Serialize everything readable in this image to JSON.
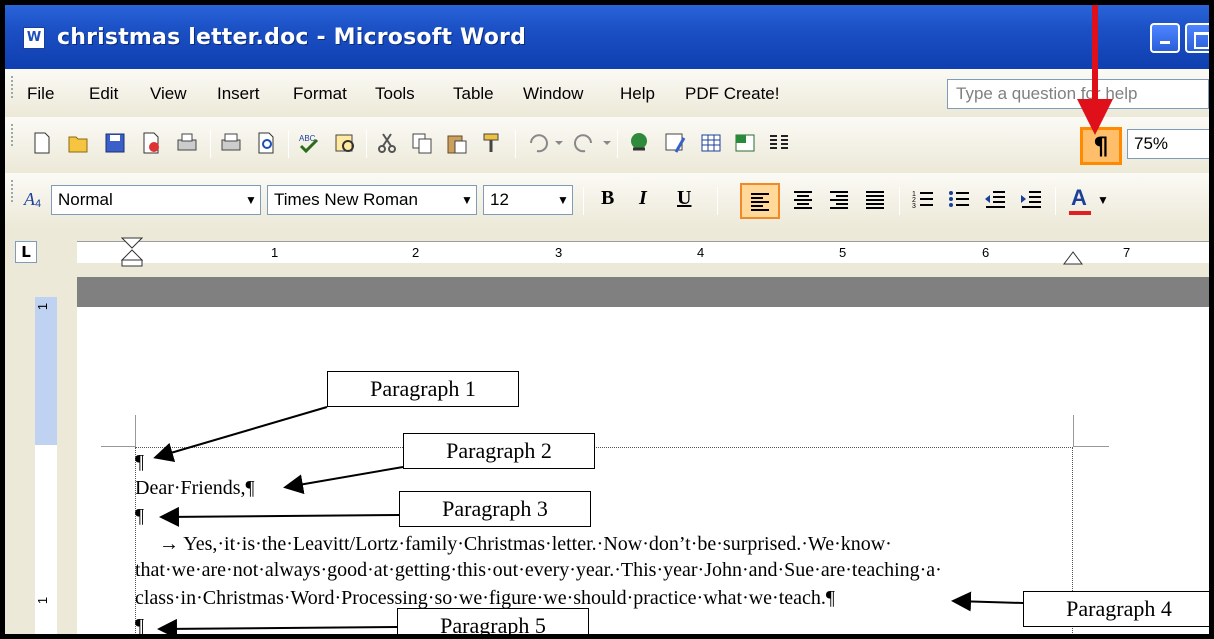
{
  "window": {
    "title": "christmas letter.doc - Microsoft Word",
    "app_icon": "word-icon"
  },
  "menu": {
    "items": [
      "File",
      "Edit",
      "View",
      "Insert",
      "Format",
      "Tools",
      "Table",
      "Window",
      "Help",
      "PDF Create!"
    ],
    "help_placeholder": "Type a question for help"
  },
  "standard_toolbar": {
    "zoom": "75%",
    "icons": [
      "new-icon",
      "open-icon",
      "save-icon",
      "permission-icon",
      "print-icon",
      "print-preview-icon",
      "spelling-icon",
      "research-icon",
      "cut-icon",
      "copy-icon",
      "paste-icon",
      "format-painter-icon",
      "undo-icon",
      "redo-icon",
      "hyperlink-icon",
      "tables-borders-icon",
      "insert-table-icon",
      "insert-excel-icon",
      "columns-icon",
      "show-hide-icon"
    ],
    "show_hide_glyph": "¶"
  },
  "formatting_toolbar": {
    "style": "Normal",
    "font": "Times New Roman",
    "size": "12",
    "bold": "B",
    "italic": "I",
    "underline": "U",
    "font_color_glyph": "A"
  },
  "ruler": {
    "numbers": [
      "1",
      "2",
      "3",
      "4",
      "5",
      "6",
      "7"
    ]
  },
  "vertical_ruler": {
    "numbers": [
      "1",
      "1"
    ]
  },
  "document": {
    "lines": [
      "¶",
      "Dear·Friends,¶",
      "¶",
      "→    Yes,·it·is·the·Leavitt/Lortz·family·Christmas·letter.·Now·don’t·be·surprised.·We·know·",
      "that·we·are·not·always·good·at·getting·this·out·every·year.·This·year·John·and·Sue·are·teaching·a·",
      "class·in·Christmas·Word·Processing·so·we·figure·we·should·practice·what·we·teach.¶",
      "¶"
    ]
  },
  "callouts": [
    "Paragraph 1",
    "Paragraph 2",
    "Paragraph 3",
    "Paragraph 4",
    "Paragraph 5"
  ],
  "colors": {
    "titlebar": "#1b4fc4",
    "highlight": "#ff8a00",
    "red_arrow": "#e0101a"
  }
}
